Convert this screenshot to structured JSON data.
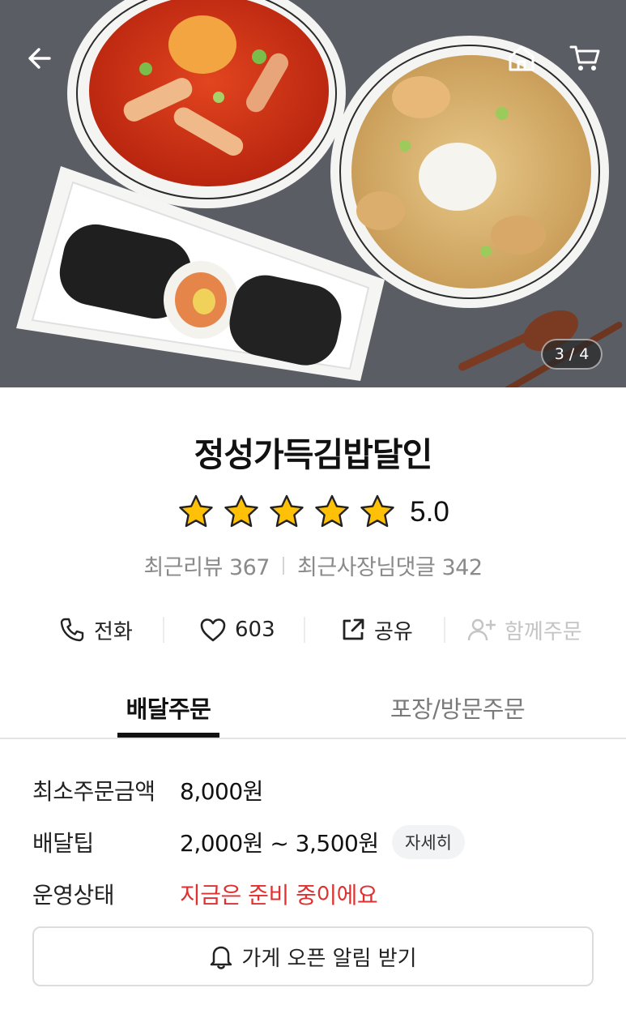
{
  "hero": {
    "image_counter_current": "3",
    "image_counter_sep": "/",
    "image_counter_total": "4"
  },
  "store": {
    "name": "정성가득김밥달인",
    "rating": "5.0",
    "stars": 5,
    "recent_reviews_label": "최근리뷰",
    "recent_reviews_count": "367",
    "owner_replies_label": "최근사장님댓글",
    "owner_replies_count": "342"
  },
  "actions": {
    "phone_label": "전화",
    "like_count": "603",
    "share_label": "공유",
    "group_order_label": "함께주문"
  },
  "tabs": [
    {
      "label": "배달주문",
      "active": true
    },
    {
      "label": "포장/방문주문",
      "active": false
    }
  ],
  "info": {
    "min_order_label": "최소주문금액",
    "min_order_value": "8,000원",
    "delivery_tip_label": "배달팁",
    "delivery_tip_value": "2,000원 ~ 3,500원",
    "detail_label": "자세히",
    "status_label": "운영상태",
    "status_value": "지금은 준비 중이에요",
    "notify_button_label": "가게 오픈 알림 받기"
  },
  "colors": {
    "star": "#ffc107",
    "status": "#e03131",
    "active_tab": "#111111"
  }
}
